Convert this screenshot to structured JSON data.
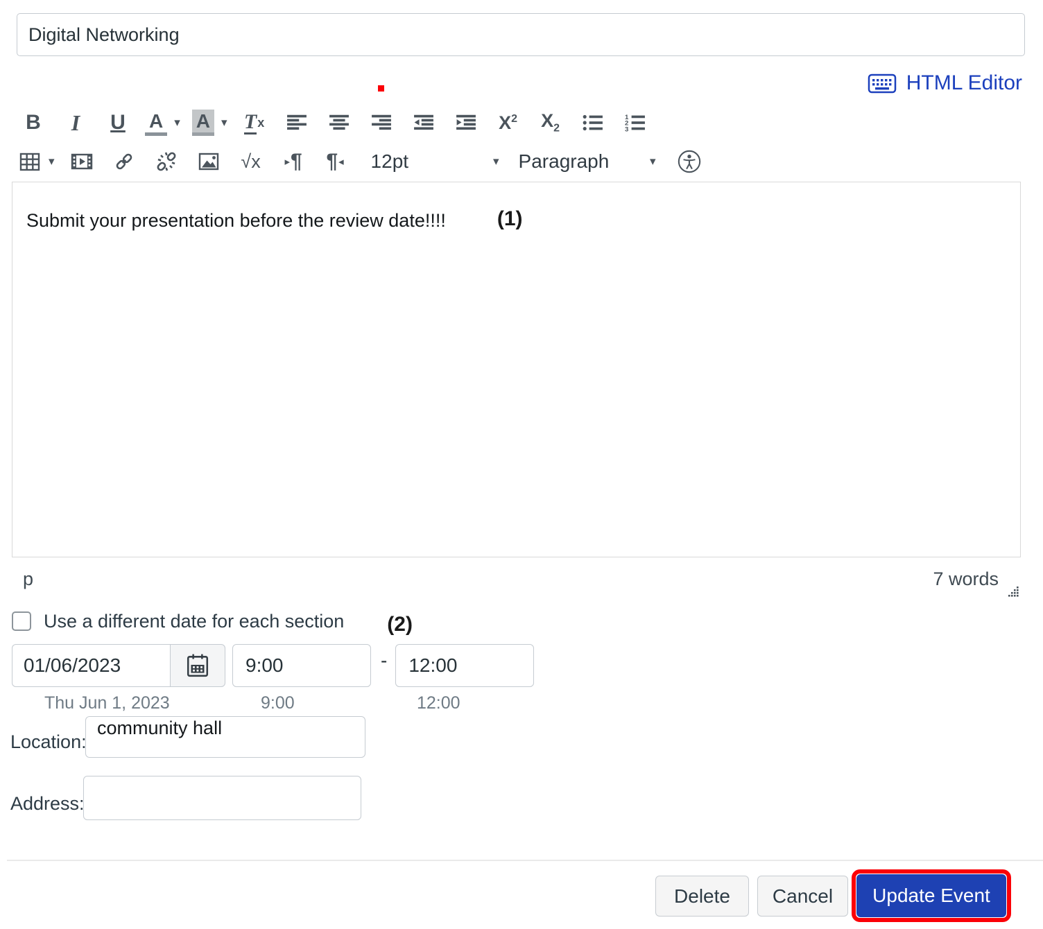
{
  "title": {
    "value": "Digital Networking"
  },
  "html_editor_link": {
    "label": "HTML Editor"
  },
  "toolbar": {
    "bold": "B",
    "italic": "I",
    "underline": "U",
    "text_color": "A",
    "bg_color": "A",
    "clear_fmt_t": "T",
    "clear_fmt_x": "x",
    "sup_base": "X",
    "sup_exp": "2",
    "sub_base": "X",
    "sub_exp": "2",
    "equation": "√x",
    "ltr_pilcrow": "¶",
    "rtl_pilcrow": "¶",
    "ltr_marker": "▸",
    "rtl_marker": "◂",
    "caret": "▾",
    "font_size": "12pt",
    "paragraph_format": "Paragraph"
  },
  "editor": {
    "content": "Submit your presentation before the review date!!!!",
    "annotation_1": "(1)",
    "element_path": "p",
    "word_count": "7 words"
  },
  "options": {
    "different_date_label": "Use a different date for each section",
    "annotation_2": "(2)",
    "checkbox_checked": false
  },
  "datetime": {
    "date_value": "01/06/2023",
    "date_help": "Thu Jun 1, 2023",
    "start_value": "9:00",
    "start_help": "9:00",
    "range_separator": "-",
    "end_value": "12:00",
    "end_help": "12:00"
  },
  "location": {
    "label": "Location:",
    "value": "community hall"
  },
  "address": {
    "label": "Address:",
    "value": ""
  },
  "actions": {
    "delete_label": "Delete",
    "cancel_label": "Cancel",
    "update_label": "Update Event"
  },
  "colors": {
    "link_blue": "#1c40bd",
    "button_blue": "#1e41b3",
    "annotation_red": "#fb0007",
    "icon_gray": "#4b545c"
  }
}
